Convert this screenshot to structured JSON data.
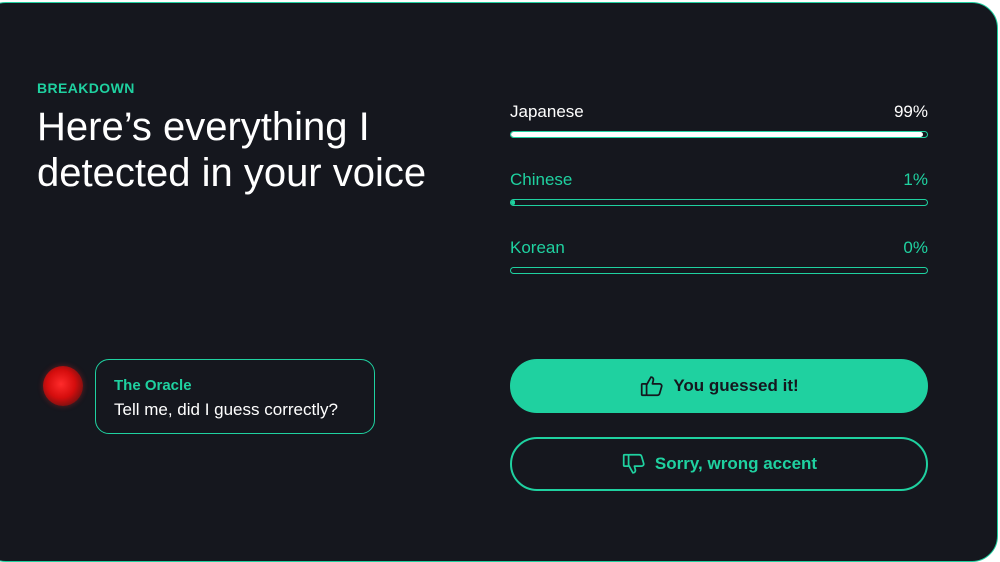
{
  "header": {
    "eyebrow": "BREAKDOWN",
    "title": "Here’s everything I detected in your voice"
  },
  "accents": [
    {
      "label": "Japanese",
      "percent_text": "99%",
      "percent": 99
    },
    {
      "label": "Chinese",
      "percent_text": "1%",
      "percent": 1
    },
    {
      "label": "Korean",
      "percent_text": "0%",
      "percent": 0
    }
  ],
  "chat": {
    "name": "The Oracle",
    "message": "Tell me, did I guess correctly?"
  },
  "actions": {
    "confirm_label": "You guessed it!",
    "confirm_icon": "thumbs-up-icon",
    "reject_label": "Sorry, wrong accent",
    "reject_icon": "thumbs-down-icon"
  },
  "colors": {
    "background": "#15171e",
    "accent": "#1fd1a0",
    "text": "#ffffff",
    "avatar": "#e01414"
  }
}
